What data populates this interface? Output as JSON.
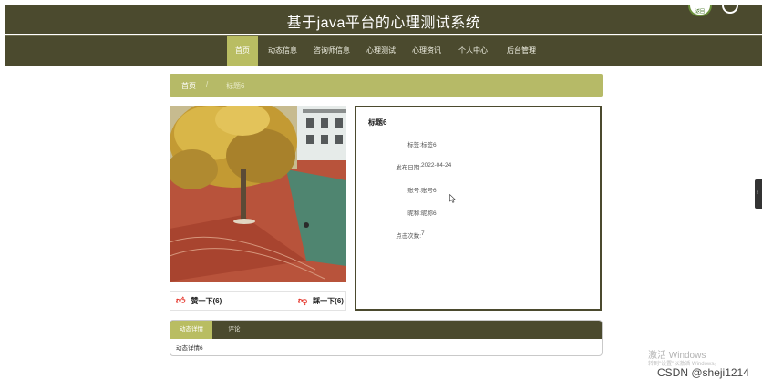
{
  "header": {
    "title": "基于java平台的心理测试系统",
    "badge_text": "返回"
  },
  "nav": {
    "items": [
      {
        "label": "首页",
        "active": true
      },
      {
        "label": "动态信息"
      },
      {
        "label": "咨询师信息"
      },
      {
        "label": "心理测试"
      },
      {
        "label": "心理资讯"
      },
      {
        "label": "个人中心"
      },
      {
        "label": "后台管理"
      }
    ]
  },
  "breadcrumb": {
    "home": "首页",
    "separator": "/",
    "current": "标题6"
  },
  "votes": {
    "up_label": "赞一下(6)",
    "down_label": "踩一下(6)"
  },
  "detail": {
    "title": "标题6",
    "fields": [
      {
        "label": "标签:",
        "value": "标签6"
      },
      {
        "label": "发布日期:",
        "value": "2022-04-24"
      },
      {
        "label": "账号:",
        "value": "账号6"
      },
      {
        "label": "昵称:",
        "value": "昵称6"
      },
      {
        "label": "点击次数:",
        "value": "7"
      }
    ]
  },
  "tabs": {
    "items": [
      {
        "label": "动态详情",
        "active": true
      },
      {
        "label": "评论"
      }
    ],
    "content": "动态详情6"
  },
  "watermark": {
    "line1": "激活 Windows",
    "line2": "转到\"设置\"以激活 Windows。"
  },
  "credit": "CSDN @sheji1214",
  "colors": {
    "dark_olive": "#4b4a2e",
    "olive_accent": "#b9bd62",
    "red_icon": "#e5362c"
  }
}
